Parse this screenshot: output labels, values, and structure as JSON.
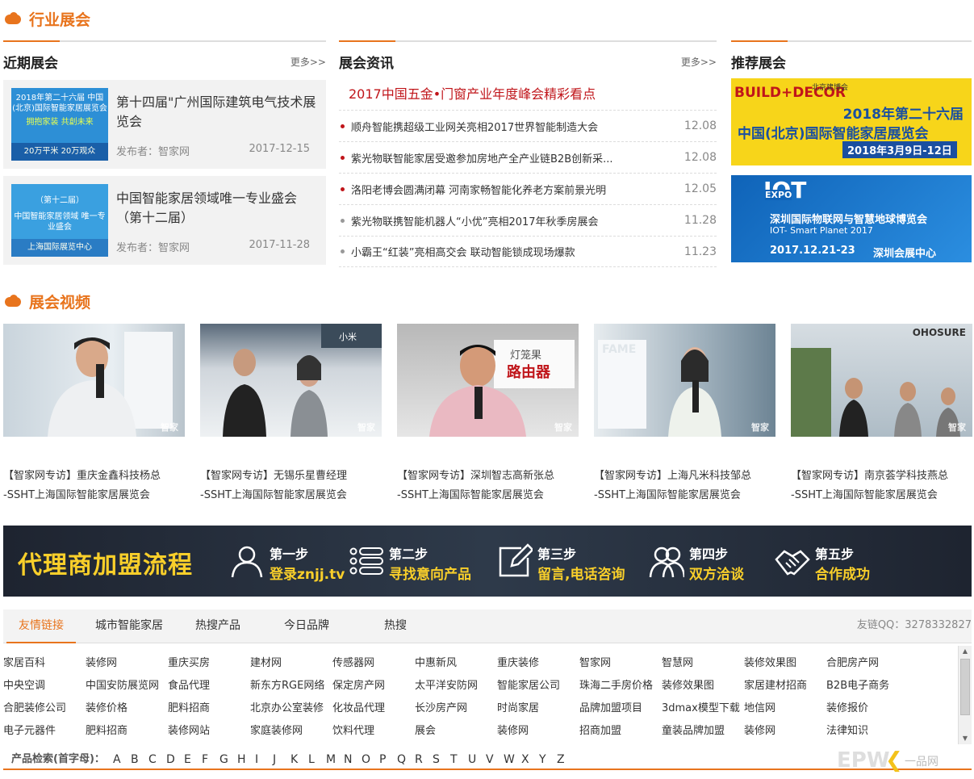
{
  "sections": {
    "industry_title": "行业展会",
    "video_title": "展会视频"
  },
  "recent": {
    "title": "近期展会",
    "more": "更多>>",
    "items": [
      {
        "title": "第十四届\"广州国际建筑电气技术展览会",
        "publisher": "发布者：智家网",
        "date": "2017-12-15",
        "thumb_top": "2018年第二十六届 中国(北京)国际智能家居展览会",
        "thumb_mid": "拥抱家装 共創未来",
        "thumb_bar": "20万平米 20万观众"
      },
      {
        "title": "中国智能家居领域唯一专业盛会（第十二届）",
        "publisher": "发布者：智家网",
        "date": "2017-11-28",
        "thumb_top": "（第十二届）",
        "thumb_mid": "中国智能家居领域 唯一专业盛会",
        "thumb_bar": "上海国际展览中心"
      }
    ]
  },
  "news": {
    "title": "展会资讯",
    "more": "更多>>",
    "headline": "2017中国五金•门窗产业年度峰会精彩看点",
    "items": [
      {
        "text": "顺舟智能携超级工业网关亮相2017世界智能制造大会",
        "date": "12.08",
        "dot": "red"
      },
      {
        "text": "紫光物联智能家居受邀参加房地产全产业链B2B创新采...",
        "date": "12.08",
        "dot": "red"
      },
      {
        "text": "洛阳老博会圆满闭幕 河南家畅智能化养老方案前景光明",
        "date": "12.05",
        "dot": "red"
      },
      {
        "text": "紫光物联携智能机器人“小优”亮相2017年秋季房展会",
        "date": "11.28",
        "dot": "gray"
      },
      {
        "text": "小霸王“红装”亮相高交会 联动智能锁成现场爆款",
        "date": "11.23",
        "dot": "gray"
      }
    ]
  },
  "recommend": {
    "title": "推荐展会",
    "ad1": {
      "brand": "BUILD+DECOR",
      "org": "北京建博会",
      "line1": "2018年第二十六届",
      "line2": "中国(北京)国际智能家居展览会",
      "line3": "2018年3月9日-12日"
    },
    "ad2": {
      "brand": "IOT",
      "expo": "EXPO",
      "line1": "深圳国际物联网与智慧地球博览会",
      "line2": "IOT- Smart Planet 2017",
      "line3": "2017.12.21-23",
      "line4": "深圳会展中心"
    }
  },
  "videos": [
    {
      "caption1": "【智家网专访】重庆金鑫科技杨总",
      "caption2": "-SSHT上海国际智能家居展览会",
      "watermark": "智家"
    },
    {
      "caption1": "【智家网专访】无锡乐星曹经理",
      "caption2": "-SSHT上海国际智能家居展览会",
      "watermark": "智家"
    },
    {
      "caption1": "【智家网专访】深圳智志高新张总",
      "caption2": "-SSHT上海国际智能家居展览会",
      "watermark": "智家"
    },
    {
      "caption1": "【智家网专访】上海凡米科技邹总",
      "caption2": "-SSHT上海国际智能家居展览会",
      "watermark": "智家"
    },
    {
      "caption1": "【智家网专访】南京荟学科技燕总",
      "caption2": "-SSHT上海国际智能家居展览会",
      "watermark": "智家"
    }
  ],
  "video_props": {
    "v2_sign": "小米",
    "v3_sign_a": "灯笼果",
    "v3_sign_b": "路由器",
    "v4_sign": "FAME",
    "v5_sign": "OHOSURE"
  },
  "banner": {
    "title": "代理商加盟流程",
    "steps": [
      {
        "label": "第一步",
        "action": "登录znjj.tv",
        "icon": "user-icon"
      },
      {
        "label": "第二步",
        "action": "寻找意向产品",
        "icon": "list-icon"
      },
      {
        "label": "第三步",
        "action": "留言,电话咨询",
        "icon": "edit-icon"
      },
      {
        "label": "第四步",
        "action": "双方洽谈",
        "icon": "people-icon"
      },
      {
        "label": "第五步",
        "action": "合作成功",
        "icon": "handshake-icon"
      }
    ]
  },
  "tabs": {
    "items": [
      "友情链接",
      "城市智能家居",
      "热搜产品",
      "今日品牌",
      "热搜"
    ],
    "qq": "友链QQ：3278332827"
  },
  "links": [
    [
      "家居百科",
      "装修网",
      "重庆买房",
      "建材网",
      "传感器网",
      "中惠新风",
      "重庆装修",
      "智家网",
      "智慧网",
      "装修效果图",
      "合肥房产网"
    ],
    [
      "中央空调",
      "中国安防展览网",
      "食品代理",
      "新东方RGE网络",
      "保定房产网",
      "太平洋安防网",
      "智能家居公司",
      "珠海二手房价格",
      "装修效果图",
      "家居建材招商",
      "B2B电子商务"
    ],
    [
      "合肥装修公司",
      "装修价格",
      "肥料招商",
      "北京办公室装修",
      "化妆品代理",
      "长沙房产网",
      "时尚家居",
      "品牌加盟项目",
      "3dmax模型下载",
      "地信网",
      "装修报价"
    ],
    [
      "电子元器件",
      "肥料招商",
      "装修网站",
      "家庭装修网",
      "饮料代理",
      "展会",
      "装修网",
      "招商加盟",
      "童装品牌加盟",
      "装修网",
      "法律知识"
    ]
  ],
  "alpha": {
    "label": "产品检索(首字母)：",
    "letters": [
      "A",
      "B",
      "C",
      "D",
      "E",
      "F",
      "G",
      "H",
      "I",
      "J",
      "K",
      "L",
      "M",
      "N",
      "O",
      "P",
      "Q",
      "R",
      "S",
      "T",
      "U",
      "V",
      "W",
      "X",
      "Y",
      "Z"
    ]
  },
  "corner_logo": {
    "text": "EPW",
    "cn": "一品网"
  },
  "colors": {
    "accent": "#e8741d",
    "headline_red": "#c0151a",
    "banner_yellow": "#f9cf2a"
  }
}
